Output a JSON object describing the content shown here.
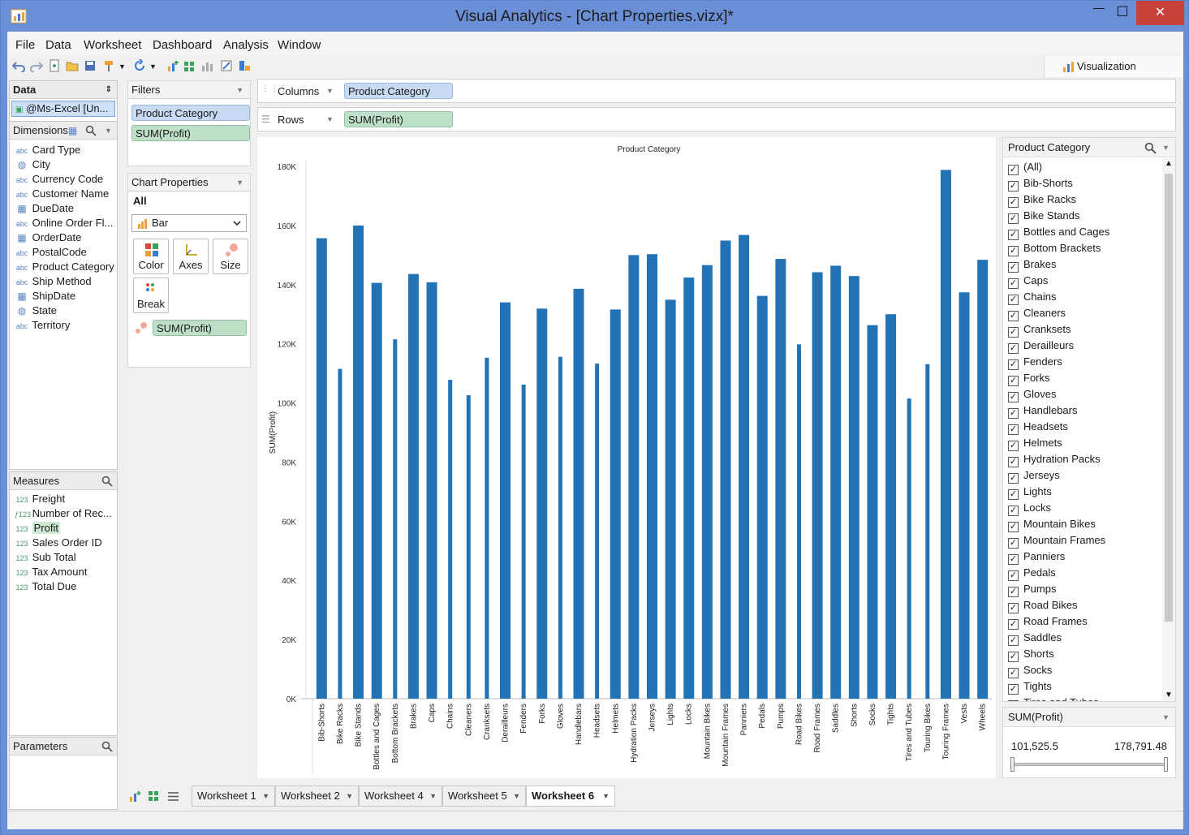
{
  "window": {
    "title": "Visual Analytics - [Chart Properties.vizx]*",
    "minimize": "—",
    "maximize": "☐",
    "close": "✕"
  },
  "menu": [
    "File",
    "Data",
    "Worksheet",
    "Dashboard",
    "Analysis",
    "Window"
  ],
  "visualization_tab": "Visualization",
  "data_panel": {
    "header": "Data",
    "source": "@Ms-Excel [Un..."
  },
  "dimensions": {
    "header": "Dimensions",
    "items": [
      {
        "icon": "abc",
        "label": "Card Type"
      },
      {
        "icon": "globe",
        "label": "City"
      },
      {
        "icon": "abc",
        "label": "Currency Code"
      },
      {
        "icon": "abc",
        "label": "Customer Name"
      },
      {
        "icon": "calendar",
        "label": "DueDate"
      },
      {
        "icon": "abc",
        "label": "Online Order Fl..."
      },
      {
        "icon": "calendar",
        "label": "OrderDate"
      },
      {
        "icon": "abc",
        "label": "PostalCode"
      },
      {
        "icon": "abc",
        "label": "Product Category"
      },
      {
        "icon": "abc",
        "label": "Ship Method"
      },
      {
        "icon": "calendar",
        "label": "ShipDate"
      },
      {
        "icon": "globe",
        "label": "State"
      },
      {
        "icon": "abc",
        "label": "Territory"
      }
    ]
  },
  "measures": {
    "header": "Measures",
    "items": [
      {
        "icon": "123",
        "label": "Freight"
      },
      {
        "icon": "f123",
        "label": "Number of Rec..."
      },
      {
        "icon": "123",
        "label": "Profit"
      },
      {
        "icon": "123",
        "label": "Sales Order ID"
      },
      {
        "icon": "123",
        "label": "Sub Total"
      },
      {
        "icon": "123",
        "label": "Tax Amount"
      },
      {
        "icon": "123",
        "label": "Total Due"
      }
    ]
  },
  "parameters": {
    "header": "Parameters"
  },
  "filters": {
    "header": "Filters",
    "pills": [
      "Product Category",
      "SUM(Profit)"
    ]
  },
  "chart_properties": {
    "header": "Chart Properties",
    "scope": "All",
    "chart_type": "Bar",
    "buttons": [
      "Color",
      "Axes",
      "Size",
      "Break"
    ],
    "size_pill": "SUM(Profit)"
  },
  "shelves": {
    "columns_label": "Columns",
    "columns_pill": "Product Category",
    "rows_label": "Rows",
    "rows_pill": "SUM(Profit)"
  },
  "chart_data": {
    "type": "bar",
    "title": "Product Category",
    "xlabel": "",
    "ylabel": "SUM(Profit)",
    "ylim": [
      0,
      180000
    ],
    "yticks": [
      "0K",
      "20K",
      "40K",
      "60K",
      "80K",
      "100K",
      "120K",
      "140K",
      "160K",
      "180K"
    ],
    "color": "#2272b6",
    "categories": [
      "Bib-Shorts",
      "Bike Racks",
      "Bike Stands",
      "Bottles and Cages",
      "Bottom Brackets",
      "Brakes",
      "Caps",
      "Chains",
      "Cleaners",
      "Cranksets",
      "Derailleurs",
      "Fenders",
      "Forks",
      "Gloves",
      "Handlebars",
      "Headsets",
      "Helmets",
      "Hydration Packs",
      "Jerseys",
      "Lights",
      "Locks",
      "Mountain Bikes",
      "Mountain Frames",
      "Panniers",
      "Pedals",
      "Pumps",
      "Road Bikes",
      "Road Frames",
      "Saddles",
      "Shorts",
      "Socks",
      "Tights",
      "Tires and Tubes",
      "Touring Bikes",
      "Touring Frames",
      "Vests",
      "Wheels"
    ],
    "values": [
      155700,
      111500,
      160000,
      140600,
      121500,
      143600,
      140800,
      107800,
      102600,
      115300,
      134000,
      106200,
      131900,
      115600,
      138600,
      113300,
      131600,
      150000,
      150300,
      134900,
      142400,
      146600,
      154900,
      156800,
      136200,
      148700,
      119800,
      144200,
      146400,
      142900,
      126300,
      130000,
      101500,
      113100,
      178800,
      137400,
      148400
    ],
    "bar_width": [
      "wide",
      "narrow",
      "wide",
      "wide",
      "narrow",
      "wide",
      "wide",
      "narrow",
      "narrow",
      "narrow",
      "wide",
      "narrow",
      "wide",
      "narrow",
      "wide",
      "narrow",
      "wide",
      "wide",
      "wide",
      "wide",
      "wide",
      "wide",
      "wide",
      "wide",
      "wide",
      "wide",
      "narrow",
      "wide",
      "wide",
      "wide",
      "wide",
      "wide",
      "narrow",
      "narrow",
      "wide",
      "wide",
      "wide"
    ]
  },
  "filter_list": {
    "header": "Product Category",
    "items": [
      "(All)",
      "Bib-Shorts",
      "Bike Racks",
      "Bike Stands",
      "Bottles and Cages",
      "Bottom Brackets",
      "Brakes",
      "Caps",
      "Chains",
      "Cleaners",
      "Cranksets",
      "Derailleurs",
      "Fenders",
      "Forks",
      "Gloves",
      "Handlebars",
      "Headsets",
      "Helmets",
      "Hydration Packs",
      "Jerseys",
      "Lights",
      "Locks",
      "Mountain Bikes",
      "Mountain Frames",
      "Panniers",
      "Pedals",
      "Pumps",
      "Road Bikes",
      "Road Frames",
      "Saddles",
      "Shorts",
      "Socks",
      "Tights",
      "Tires and Tubes"
    ],
    "check": "✓"
  },
  "range_filter": {
    "header": "SUM(Profit)",
    "min": "101,525.5",
    "max": "178,791.48"
  },
  "worksheet_tabs": [
    {
      "label": "Worksheet 1",
      "active": false
    },
    {
      "label": "Worksheet 2",
      "active": false
    },
    {
      "label": "Worksheet 4",
      "active": false
    },
    {
      "label": "Worksheet 5",
      "active": false
    },
    {
      "label": "Worksheet 6",
      "active": true
    }
  ]
}
